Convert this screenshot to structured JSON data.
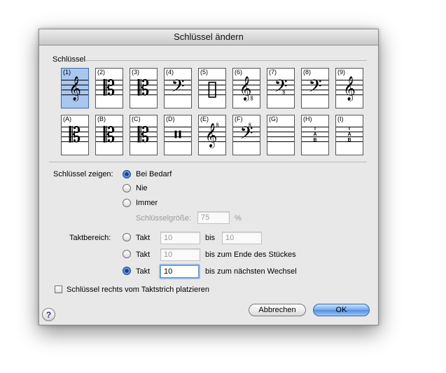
{
  "dialog": {
    "title": "Schlüssel ändern"
  },
  "clefs": {
    "group_label": "Schlüssel",
    "row1": [
      {
        "num": "(1)",
        "glyph": "𝄞",
        "icon": "treble-clef-icon",
        "selected": true
      },
      {
        "num": "(2)",
        "glyph": "𝄡",
        "icon": "alto-clef-icon"
      },
      {
        "num": "(3)",
        "glyph": "𝄡",
        "icon": "tenor-clef-icon"
      },
      {
        "num": "(4)",
        "glyph": "𝄢",
        "icon": "bass-clef-icon"
      },
      {
        "num": "(5)",
        "glyph": "▯",
        "icon": "percussion-clef-icon"
      },
      {
        "num": "(6)",
        "glyph": "𝄠",
        "icon": "treble-8vb-clef-icon"
      },
      {
        "num": "(7)",
        "glyph": "𝄤",
        "icon": "bass-8vb-clef-icon"
      },
      {
        "num": "(8)",
        "glyph": "𝄢",
        "icon": "bass-clef-icon"
      },
      {
        "num": "(9)",
        "glyph": "𝄞",
        "icon": "treble-clef-icon"
      }
    ],
    "row2": [
      {
        "num": "(A)",
        "glyph": "𝄡",
        "icon": "c-clef-icon"
      },
      {
        "num": "(B)",
        "glyph": "𝄡",
        "icon": "c-clef-icon"
      },
      {
        "num": "(C)",
        "glyph": "𝄡",
        "icon": "c-clef-icon"
      },
      {
        "num": "(D)",
        "glyph": "𝄥",
        "icon": "percussion-clef-icon"
      },
      {
        "num": "(E)",
        "glyph": "𝄟",
        "icon": "treble-8va-clef-icon"
      },
      {
        "num": "(F)",
        "glyph": "𝄣",
        "icon": "bass-8va-clef-icon"
      },
      {
        "num": "(G)",
        "glyph": "",
        "icon": "blank-clef-icon"
      },
      {
        "num": "(H)",
        "tab": "T\nA\nB",
        "icon": "tab-clef-icon"
      },
      {
        "num": "(I)",
        "tab": "T\nA\nB",
        "icon": "tab-clef-small-icon"
      }
    ]
  },
  "show": {
    "label": "Schlüssel zeigen:",
    "options": [
      "Bei Bedarf",
      "Nie",
      "Immer"
    ],
    "selected_index": 0,
    "size_label": "Schlüsselgröße:",
    "size_value": "75",
    "size_unit": "%"
  },
  "measures": {
    "label": "Taktbereich:",
    "takt": "Takt",
    "row1": {
      "from": "10",
      "to_label": "bis",
      "to": "10"
    },
    "row2": {
      "from": "10",
      "to_label": "bis zum Ende des Stückes"
    },
    "row3": {
      "from": "10",
      "to_label": "bis zum nächsten Wechsel"
    },
    "selected_index": 2
  },
  "checkbox": {
    "label": "Schlüssel rechts vom Taktstrich platzieren",
    "checked": false
  },
  "buttons": {
    "cancel": "Abbrechen",
    "ok": "OK",
    "help": "?"
  },
  "colors": {
    "selection": "#a9c6ef",
    "default_button": "#5a98e6"
  }
}
